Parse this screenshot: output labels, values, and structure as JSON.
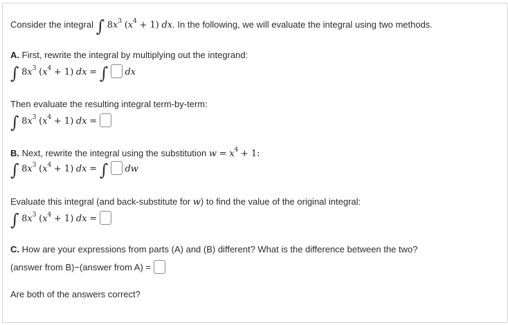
{
  "intro": {
    "before": "Consider the integral",
    "after": ". In the following, we will evaluate the integral using two methods."
  },
  "integrand": {
    "coef": "8",
    "var": "x",
    "exp1": "3",
    "open": "(",
    "exp2": "4",
    "plus_one": "+ 1)",
    "dx": "dx"
  },
  "equals": "=",
  "integral_sign": "∫",
  "partA": {
    "label": "A.",
    "instruction": "First, rewrite the integral by multiplying out the integrand:",
    "diff": "dx",
    "then_text": "Then evaluate the resulting integral term-by-term:"
  },
  "partB": {
    "label": "B.",
    "instruction": "Next, rewrite the integral using the substitution",
    "sub_var": "w",
    "sub_eq": "=",
    "sub_x": "x",
    "sub_exp": "4",
    "sub_tail": "+ 1:",
    "diff": "dw",
    "eval_text_before": "Evaluate this integral (and back-substitute for",
    "eval_var": "w",
    "eval_text_after": ") to find the value of the original integral:"
  },
  "partC": {
    "label": "C.",
    "question": "How are your expressions from parts (A) and (B) different? What is the difference between the two?",
    "difference_label": "(answer from B)−(answer from A) =",
    "final_question": "Are both of the answers correct?"
  },
  "inputs": {
    "a_integrand": "",
    "a_result": "",
    "b_integrand": "",
    "b_result": "",
    "c_difference": ""
  }
}
